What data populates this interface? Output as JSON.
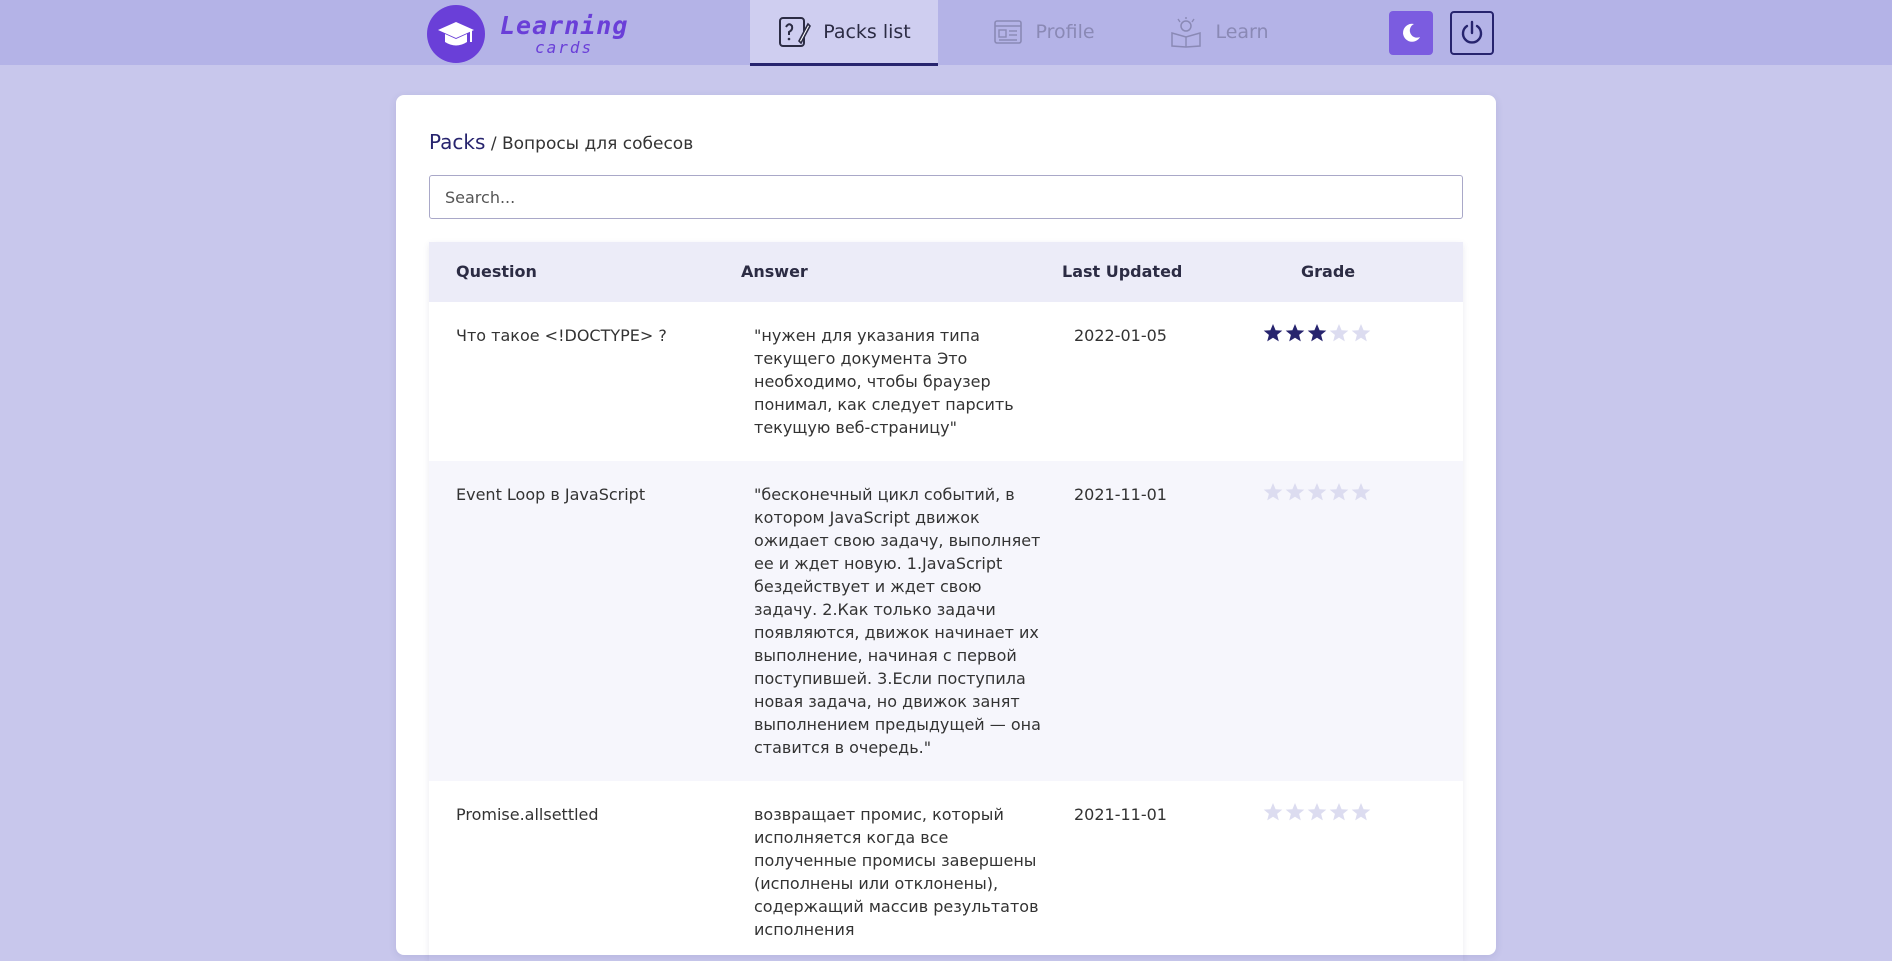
{
  "app": {
    "logo_title": "Learning",
    "logo_subtitle": "cards"
  },
  "nav": {
    "tabs": [
      {
        "label": "Packs list",
        "icon": "pack-edit-icon",
        "active": true
      },
      {
        "label": "Profile",
        "icon": "profile-card-icon",
        "active": false
      },
      {
        "label": "Learn",
        "icon": "learn-book-icon",
        "active": false
      }
    ],
    "theme_icon": "moon-icon",
    "logout_icon": "power-icon"
  },
  "breadcrumb": {
    "link": "Packs",
    "separator": " / ",
    "current": "Вопросы для собесов"
  },
  "search": {
    "placeholder": "Search...",
    "value": ""
  },
  "table": {
    "headers": {
      "question": "Question",
      "answer": "Answer",
      "last_updated": "Last Updated",
      "grade": "Grade"
    },
    "rows": [
      {
        "question": "Что такое <!DOCTYPE> ?",
        "answer": "\"нужен для указания типа текущего документа Это необходимо, чтобы браузер понимал, как следует парсить текущую веб-страницу\"",
        "last_updated": "2022-01-05",
        "grade": 3
      },
      {
        "question": "Event Loop в JavaScript",
        "answer": "\"бесконечный цикл событий, в котором JavaScript движок ожидает свою задачу, выполняет ее и ждет новую. 1.JavaScript бездействует и ждет свою задачу. 2.Как только задачи появляются, движок начинает их выполнение, начиная с первой поступившей. 3.Если поступила новая задача, но движок занят выполнением предыдущей — она ставится в очередь.\"",
        "last_updated": "2021-11-01",
        "grade": 0
      },
      {
        "question": "Promise.allsettled",
        "answer": "возвращает промис, который исполняется когда все полученные промисы завершены (исполнены или отклонены), содержащий массив результатов исполнения",
        "last_updated": "2021-11-01",
        "grade": 0
      }
    ],
    "max_grade": 5
  },
  "colors": {
    "background": "#c8c7ec",
    "header": "#b4b3e7",
    "accent": "#6a3fd8",
    "navy": "#27246e",
    "star_filled": "#27246e",
    "star_empty": "#dcdcf0"
  }
}
